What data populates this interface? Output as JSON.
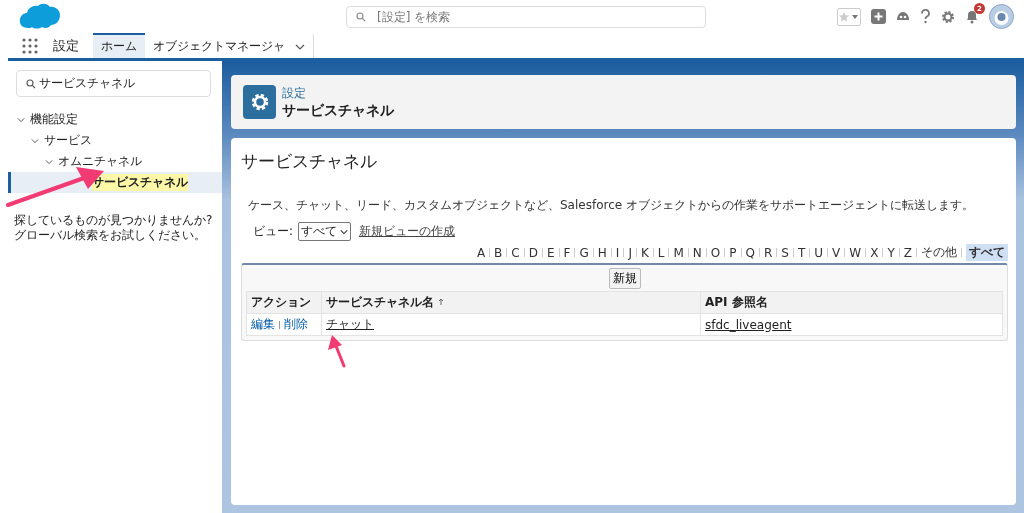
{
  "header": {
    "search": {
      "placeholder": "[設定] を検索"
    },
    "notifications": {
      "badge": "2"
    }
  },
  "nav": {
    "app_name": "設定",
    "tabs": [
      {
        "label": "ホーム",
        "selected": true,
        "kind": "plain"
      },
      {
        "label": "オブジェクトマネージャ",
        "selected": false,
        "kind": "menu"
      }
    ]
  },
  "sidebar": {
    "search": {
      "value": "サービスチャネル"
    },
    "tree": [
      {
        "label": "機能設定",
        "expanded": true,
        "selected": false,
        "highlighted": false,
        "children": [
          {
            "label": "サービス",
            "expanded": true,
            "selected": false,
            "highlighted": false,
            "children": [
              {
                "label": "オムニチャネル",
                "expanded": true,
                "selected": false,
                "highlighted": false,
                "children": [
                  {
                    "label": "サービスチャネル",
                    "selected": true,
                    "highlighted": true
                  }
                ]
              }
            ]
          }
        ]
      }
    ],
    "help_text": "探しているものが見つかりませんか?\nグローバル検索をお試しください。"
  },
  "page_header": {
    "breadcrumb": "設定",
    "title": "サービスチャネル"
  },
  "content": {
    "title": "サービスチャネル",
    "description": "ケース、チャット、リード、カスタムオブジェクトなど、Salesforce オブジェクトからの作業をサポートエージェントに転送します。",
    "view": {
      "label": "ビュー:",
      "value": "すべて"
    },
    "create_view_link": "新規ビューの作成",
    "alphabet": [
      {
        "label": "A",
        "selected": false
      },
      {
        "label": "B",
        "selected": false
      },
      {
        "label": "C",
        "selected": false
      },
      {
        "label": "D",
        "selected": false
      },
      {
        "label": "E",
        "selected": false
      },
      {
        "label": "F",
        "selected": false
      },
      {
        "label": "G",
        "selected": false
      },
      {
        "label": "H",
        "selected": false
      },
      {
        "label": "I",
        "selected": false
      },
      {
        "label": "J",
        "selected": false
      },
      {
        "label": "K",
        "selected": false
      },
      {
        "label": "L",
        "selected": false
      },
      {
        "label": "M",
        "selected": false
      },
      {
        "label": "N",
        "selected": false
      },
      {
        "label": "O",
        "selected": false
      },
      {
        "label": "P",
        "selected": false
      },
      {
        "label": "Q",
        "selected": false
      },
      {
        "label": "R",
        "selected": false
      },
      {
        "label": "S",
        "selected": false
      },
      {
        "label": "T",
        "selected": false
      },
      {
        "label": "U",
        "selected": false
      },
      {
        "label": "V",
        "selected": false
      },
      {
        "label": "W",
        "selected": false
      },
      {
        "label": "X",
        "selected": false
      },
      {
        "label": "Y",
        "selected": false
      },
      {
        "label": "Z",
        "selected": false
      },
      {
        "label": "その他",
        "selected": false
      },
      {
        "label": "すべて",
        "selected": true
      }
    ],
    "new_button": "新規",
    "table": {
      "columns": [
        {
          "label": "アクション",
          "sorted": false
        },
        {
          "label": "サービスチャネル名",
          "sorted": true
        },
        {
          "label": "API 参照名",
          "sorted": false
        }
      ],
      "rows": [
        {
          "actions": [
            "編集",
            "削除"
          ],
          "name": "チャット",
          "api_name": "sfdc_liveagent"
        }
      ]
    }
  }
}
